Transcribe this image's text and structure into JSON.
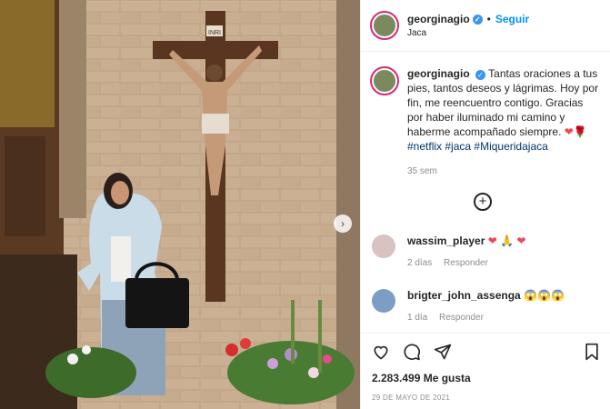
{
  "post": {
    "username": "georginagio",
    "follow_label": "Seguir",
    "location": "Jaca",
    "caption_text": "Tantas oraciones a tus pies, tantos deseos y lágrimas. Hoy por fin, me reencuentro contigo. Gracias por haber iluminado mi camino y haberme acompañado siempre.",
    "caption_emoji": "❤🌹",
    "hashtags": [
      "#netflix",
      "#jaca",
      "#Miqueridajaca"
    ],
    "age": "35 sem",
    "likes": "2.283.499 Me gusta",
    "date": "29 DE MAYO DE 2021",
    "inri": "INRI"
  },
  "comments": [
    {
      "user": "wassim_player",
      "text": "❤ 🙏 ❤",
      "age": "2 días",
      "reply": "Responder"
    },
    {
      "user": "brigter_john_assenga",
      "text": "😱😱😱",
      "age": "1 día",
      "reply": "Responder"
    }
  ],
  "colors": {
    "accent": "#0095f6",
    "link": "#00376b",
    "heart": "#ed4956",
    "verified": "#3897f0"
  }
}
